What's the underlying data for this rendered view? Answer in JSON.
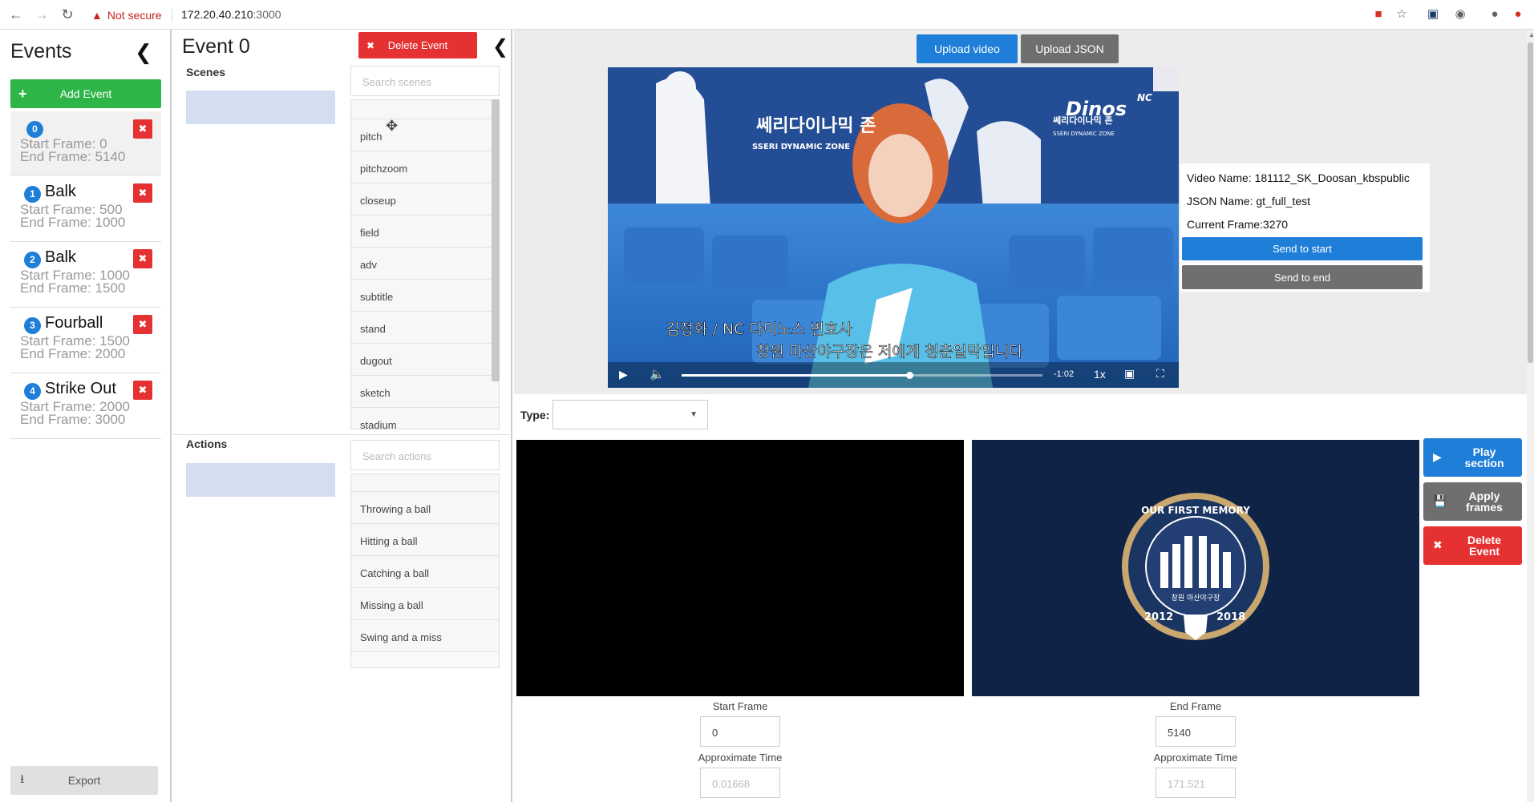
{
  "browser": {
    "not_secure": "Not secure",
    "url_host": "172.20.40.210",
    "url_port": ":3000"
  },
  "sidebar": {
    "title": "Events",
    "add_event": "Add Event",
    "export": "Export",
    "events": [
      {
        "num": "0",
        "name": "",
        "start": "Start Frame: 0",
        "end": "End Frame: 5140",
        "selected": true
      },
      {
        "num": "1",
        "name": "Balk",
        "start": "Start Frame: 500",
        "end": "End Frame: 1000",
        "selected": false
      },
      {
        "num": "2",
        "name": "Balk",
        "start": "Start Frame: 1000",
        "end": "End Frame: 1500",
        "selected": false
      },
      {
        "num": "3",
        "name": "Fourball",
        "start": "Start Frame: 1500",
        "end": "End Frame: 2000",
        "selected": false
      },
      {
        "num": "4",
        "name": "Strike Out",
        "start": "Start Frame: 2000",
        "end": "End Frame: 3000",
        "selected": false
      }
    ]
  },
  "editor": {
    "title": "Event 0",
    "delete_event": "Delete Event",
    "scenes_label": "Scenes",
    "scenes_search_placeholder": "Search scenes",
    "scenes": [
      "pitch",
      "pitchzoom",
      "closeup",
      "field",
      "adv",
      "subtitle",
      "stand",
      "dugout",
      "sketch",
      "stadium"
    ],
    "actions_label": "Actions",
    "actions_search_placeholder": "Search actions",
    "actions": [
      "Throwing a ball",
      "Hitting a ball",
      "Catching a ball",
      "Missing a ball",
      "Swing and a miss"
    ]
  },
  "video": {
    "upload_video": "Upload video",
    "upload_json": "Upload JSON",
    "caption_line1": "김정화 / NC 다이노스 변호사",
    "caption_line2": "창원 마산야구장은 저에게 청춘일막입니다",
    "zone_text_kr": "쎄리다이나믹 존",
    "zone_text_en": "SSERI DYNAMIC ZONE",
    "brand": "Dinos",
    "brand_small": "NC",
    "time_remaining": "-1:02",
    "speed": "1x",
    "progress": 0.63
  },
  "info": {
    "video_name": "Video Name: 181112_SK_Doosan_kbspublic",
    "json_name": "JSON Name: gt_full_test",
    "current_frame": "Current Frame:3270",
    "send_to_start": "Send to start",
    "send_to_end": "Send to end"
  },
  "type": {
    "label": "Type:",
    "value": ""
  },
  "frames": {
    "start_label": "Start Frame",
    "start_value": "0",
    "start_time_label": "Approximate Time",
    "start_time": "0.01668",
    "end_label": "End Frame",
    "end_value": "5140",
    "end_time_label": "Approximate Time",
    "end_time": "171.521",
    "logo_top": "OUR FIRST MEMORY",
    "logo_kr": "창원 마산야구장",
    "logo_left_year": "2012",
    "logo_right_year": "2018",
    "play_section": "Play section",
    "apply_frames": "Apply frames",
    "delete_event": "Delete Event"
  },
  "colors": {
    "primary": "#1e7ed8",
    "danger": "#e53131",
    "success": "#2eb547",
    "secondary": "#6f6f6f",
    "drop_zone": "#d3dff0"
  }
}
